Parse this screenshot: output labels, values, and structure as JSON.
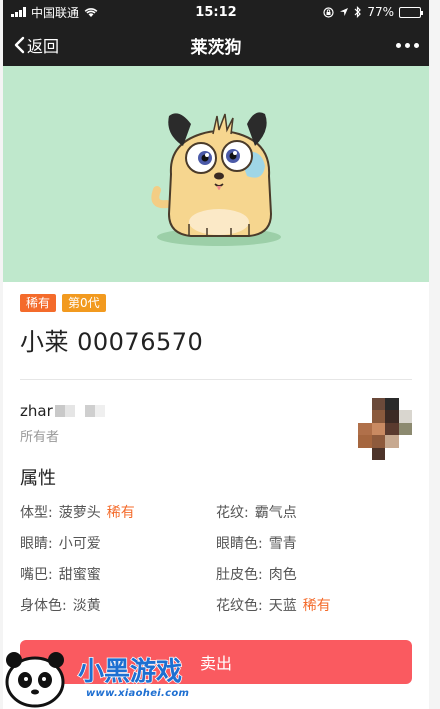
{
  "status_bar": {
    "carrier": "中国联通",
    "time": "15:12",
    "battery": "77%",
    "battery_level": 0.77
  },
  "nav": {
    "back_label": "返回",
    "title": "莱茨狗"
  },
  "dog": {
    "badges": [
      "稀有",
      "第0代"
    ],
    "name": "小莱 00076570",
    "hero_bg": "#bfe8cc"
  },
  "owner": {
    "name": "zhar",
    "label": "所有者"
  },
  "attributes": {
    "title": "属性",
    "rare_label": "稀有",
    "items": [
      {
        "key": "体型:",
        "value": "菠萝头",
        "rare": "稀有"
      },
      {
        "key": "花纹:",
        "value": "霸气点",
        "rare": ""
      },
      {
        "key": "眼睛:",
        "value": "小可爱",
        "rare": ""
      },
      {
        "key": "眼睛色:",
        "value": "雪青",
        "rare": ""
      },
      {
        "key": "嘴巴:",
        "value": "甜蜜蜜",
        "rare": ""
      },
      {
        "key": "肚皮色:",
        "value": "肉色",
        "rare": ""
      },
      {
        "key": "身体色:",
        "value": "淡黄",
        "rare": ""
      },
      {
        "key": "花纹色:",
        "value": "天蓝",
        "rare": "稀有"
      }
    ]
  },
  "actions": {
    "sell_label": "卖出"
  },
  "watermark": {
    "text": "小黑游戏",
    "url": "www.xiaohei.com"
  },
  "colors": {
    "accent": "#fa5a60",
    "rare": "#f46b2b",
    "generation": "#f29a1f"
  }
}
